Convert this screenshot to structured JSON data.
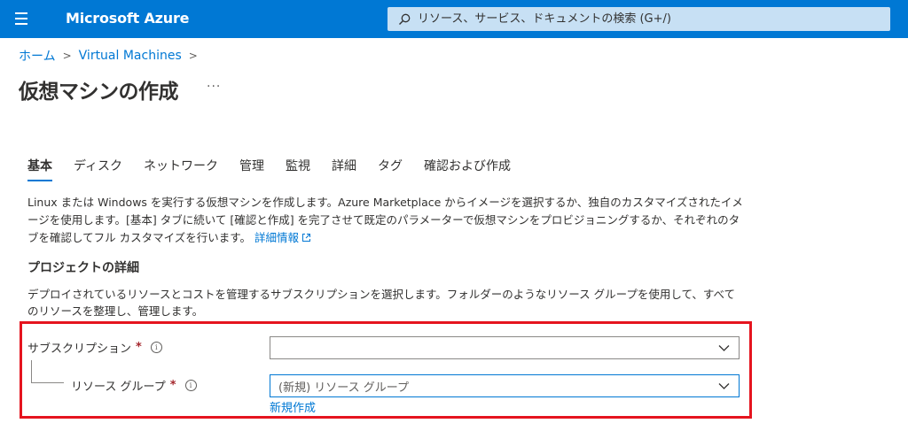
{
  "topbar": {
    "brand": "Microsoft Azure",
    "search_placeholder": "リソース、サービス、ドキュメントの検索 (G+/)"
  },
  "breadcrumb": {
    "home": "ホーム",
    "current": "Virtual Machines",
    "separator": ">"
  },
  "page": {
    "title": "仮想マシンの作成",
    "more": "···"
  },
  "tabs": [
    {
      "label": "基本",
      "active": true
    },
    {
      "label": "ディスク"
    },
    {
      "label": "ネットワーク"
    },
    {
      "label": "管理"
    },
    {
      "label": "監視"
    },
    {
      "label": "詳細"
    },
    {
      "label": "タグ"
    },
    {
      "label": "確認および作成"
    }
  ],
  "intro": {
    "text": "Linux または Windows を実行する仮想マシンを作成します。Azure Marketplace からイメージを選択するか、独自のカスタマイズされたイメージを使用します。[基本] タブに続いて [確認と作成] を完了させて既定のパラメーターで仮想マシンをプロビジョニングするか、それぞれのタブを確認してフル カスタマイズを行います。",
    "link": "詳細情報"
  },
  "project": {
    "title": "プロジェクトの詳細",
    "description": "デプロイされているリソースとコストを管理するサブスクリプションを選択します。フォルダーのようなリソース グループを使用して、すべてのリソースを整理し、管理します。",
    "subscription": {
      "label": "サブスクリプション",
      "required": "*",
      "value": ""
    },
    "resource_group": {
      "label": "リソース グループ",
      "required": "*",
      "value": "(新規) リソース グループ",
      "create_new": "新規作成"
    }
  },
  "colors": {
    "accent": "#0078d4",
    "highlight": "#e5141f",
    "required": "#a4262c"
  }
}
